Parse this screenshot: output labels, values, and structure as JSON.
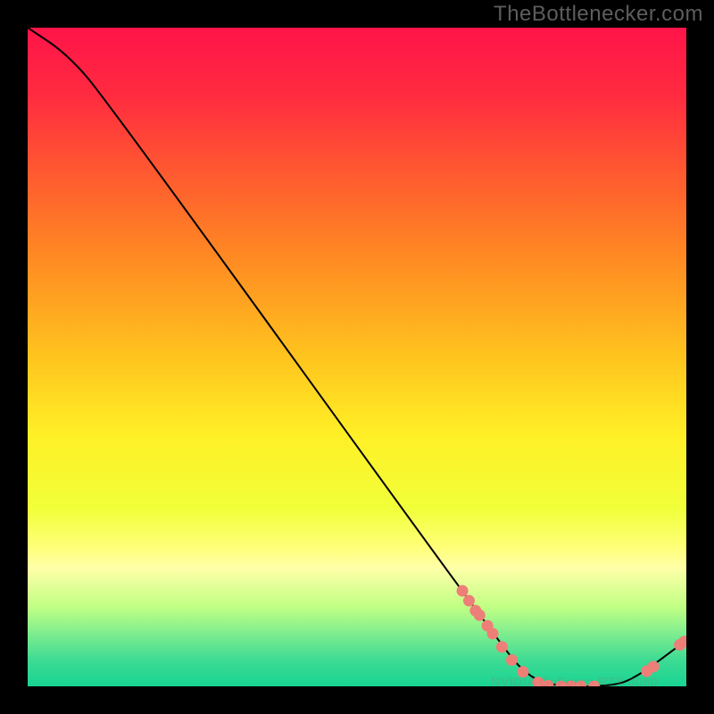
{
  "watermark": "TheBottlenecker.com",
  "chart_data": {
    "type": "line",
    "title": "",
    "xlabel": "",
    "ylabel": "",
    "xlim": [
      0,
      100
    ],
    "ylim": [
      0,
      100
    ],
    "grid": false,
    "curve": [
      {
        "x": 0,
        "y": 100
      },
      {
        "x": 6,
        "y": 96
      },
      {
        "x": 12,
        "y": 89
      },
      {
        "x": 72,
        "y": 6
      },
      {
        "x": 76,
        "y": 1.5
      },
      {
        "x": 80,
        "y": 0
      },
      {
        "x": 88,
        "y": 0
      },
      {
        "x": 92,
        "y": 1
      },
      {
        "x": 100,
        "y": 7
      }
    ],
    "markers": [
      {
        "x": 66,
        "y": 14.5
      },
      {
        "x": 67,
        "y": 13
      },
      {
        "x": 68,
        "y": 11.5
      },
      {
        "x": 68.6,
        "y": 10.8
      },
      {
        "x": 69.8,
        "y": 9.2
      },
      {
        "x": 70.6,
        "y": 8.0
      },
      {
        "x": 72,
        "y": 6.0
      },
      {
        "x": 73.5,
        "y": 4.0
      },
      {
        "x": 75.2,
        "y": 2.2
      },
      {
        "x": 77.5,
        "y": 0.6
      },
      {
        "x": 79,
        "y": 0.1
      },
      {
        "x": 81,
        "y": 0.0
      },
      {
        "x": 82.5,
        "y": 0.0
      },
      {
        "x": 84,
        "y": 0.0
      },
      {
        "x": 86,
        "y": 0.0
      },
      {
        "x": 94,
        "y": 2.3
      },
      {
        "x": 95,
        "y": 3.0
      },
      {
        "x": 99,
        "y": 6.3
      },
      {
        "x": 99.7,
        "y": 6.8
      }
    ],
    "marker_radius": 6.5,
    "marker_color": "#ed7f78",
    "line_color": "#000000",
    "line_width": 2,
    "track_label_text": "NVIDIA GeForce RTX 3080",
    "gradient_stops": [
      {
        "offset": 0.0,
        "color": "#ff1449"
      },
      {
        "offset": 0.1,
        "color": "#ff2a40"
      },
      {
        "offset": 0.22,
        "color": "#ff5930"
      },
      {
        "offset": 0.35,
        "color": "#ff8a22"
      },
      {
        "offset": 0.5,
        "color": "#ffc41e"
      },
      {
        "offset": 0.62,
        "color": "#fff026"
      },
      {
        "offset": 0.73,
        "color": "#f0ff39"
      },
      {
        "offset": 0.79,
        "color": "#ffff7a"
      },
      {
        "offset": 0.82,
        "color": "#ffffa8"
      },
      {
        "offset": 0.88,
        "color": "#c0ff84"
      },
      {
        "offset": 0.92,
        "color": "#7eed8f"
      },
      {
        "offset": 0.96,
        "color": "#3edb93"
      },
      {
        "offset": 1.0,
        "color": "#18d493"
      }
    ]
  }
}
